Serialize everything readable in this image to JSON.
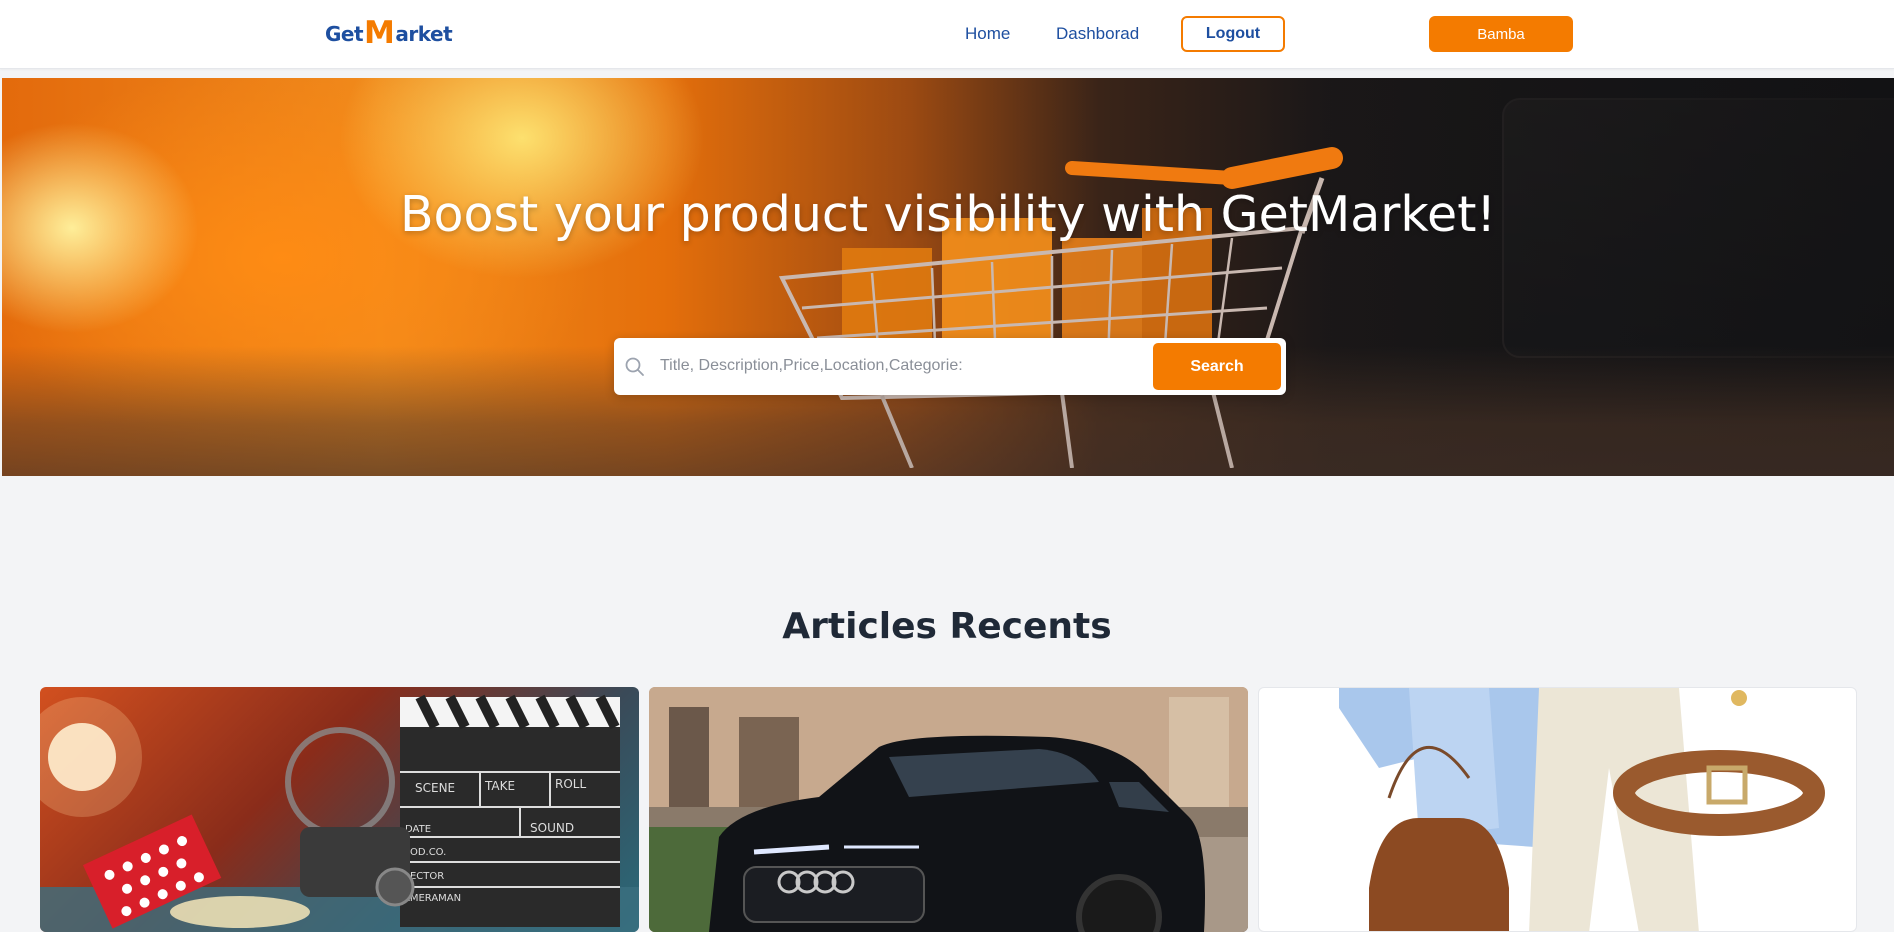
{
  "navbar": {
    "logo_prefix": "Get",
    "logo_m": "M",
    "logo_suffix": "arket",
    "links": [
      {
        "label": "Home"
      },
      {
        "label": "Dashborad"
      }
    ],
    "logout_label": "Logout",
    "user_label": "Bamba"
  },
  "hero": {
    "title": "Boost your product visibility with GetMarket!",
    "search": {
      "placeholder": "Title, Description,Price,Location,Categorie:",
      "value": "",
      "button_label": "Search"
    }
  },
  "section": {
    "title": "Articles Recents"
  },
  "articles": [
    {
      "image_subject": "movie-clapperboard-camera-popcorn",
      "clapper": {
        "scene": "SCENE",
        "take": "TAKE",
        "roll": "ROLL",
        "date": "DATE",
        "sound": "SOUND",
        "prod": "ROD.CO.",
        "director": "RECTOR",
        "camera": "AMERAMAN"
      }
    },
    {
      "image_subject": "black-suv-car"
    },
    {
      "image_subject": "shirt-handbag-belt-trousers"
    }
  ],
  "colors": {
    "brand_blue": "#1e4fa0",
    "accent_orange": "#f47b00",
    "background": "#f3f4f6"
  }
}
